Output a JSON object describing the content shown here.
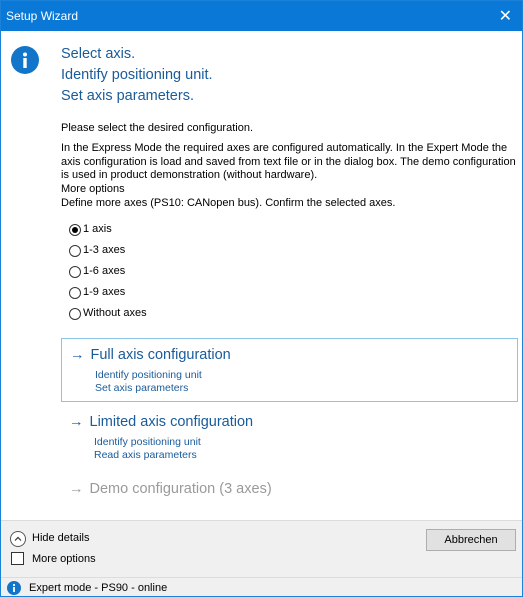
{
  "window": {
    "title": "Setup Wizard",
    "close_glyph": "✕"
  },
  "header": {
    "icon": "info-icon",
    "line1": "Select axis.",
    "line2": "Identify positioning unit.",
    "line3": "Set axis parameters."
  },
  "body": {
    "prompt": "Please select the desired configuration.",
    "description": "In the Express Mode the required axes are configured automatically. In the Expert Mode the axis configuration is load and saved from text file or in the dialog box. The demo configuration is used in product demonstration (without hardware).",
    "more_options_heading": "More options",
    "more_options_text": "Define more axes (PS10: CANopen bus). Confirm the selected axes."
  },
  "axis_options": [
    {
      "label": "1 axis",
      "checked": true
    },
    {
      "label": "1-3 axes",
      "checked": false
    },
    {
      "label": "1-6 axes",
      "checked": false
    },
    {
      "label": "1-9 axes",
      "checked": false
    },
    {
      "label": "Without axes",
      "checked": false
    }
  ],
  "commands": {
    "full": {
      "arrow": "→",
      "label": "Full axis configuration",
      "sub1": "Identify positioning unit",
      "sub2": "Set axis parameters"
    },
    "limited": {
      "arrow": "→",
      "label": "Limited axis configuration",
      "sub1": "Identify positioning unit",
      "sub2": "Read axis parameters"
    },
    "demo": {
      "arrow": "→",
      "label": "Demo configuration (3 axes)",
      "enabled": false
    }
  },
  "footer": {
    "hide_details_label": "Hide details",
    "more_options_label": "More options",
    "more_options_checked": false,
    "cancel_label": "Abbrechen"
  },
  "status": {
    "icon": "info-icon",
    "text": "Expert mode - PS90 - online"
  },
  "colors": {
    "titlebar": "#0a78d7",
    "accent_text": "#1a5b9a",
    "info_icon": "#1275c9",
    "disabled_text": "#9a9a9a"
  }
}
